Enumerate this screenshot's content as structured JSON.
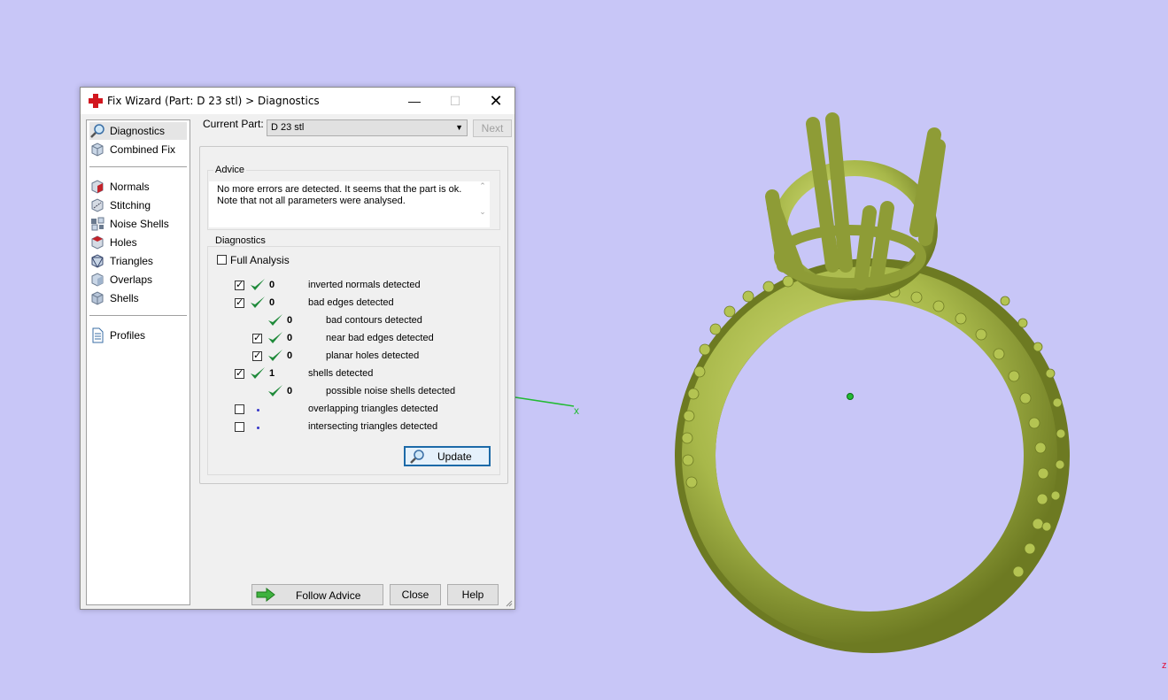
{
  "window": {
    "title": "Fix Wizard (Part: D 23 stl) > Diagnostics",
    "minimize": "—",
    "maximize": "☐",
    "close": "✕"
  },
  "nav": {
    "top_items": [
      {
        "label": "Diagnostics",
        "icon": "magnifier-icon",
        "selected": true
      },
      {
        "label": "Combined Fix",
        "icon": "cube-icon",
        "selected": false
      }
    ],
    "fix_items": [
      {
        "label": "Normals",
        "icon": "normals-cube-icon"
      },
      {
        "label": "Stitching",
        "icon": "stitching-cube-icon"
      },
      {
        "label": "Noise Shells",
        "icon": "noise-shells-icon"
      },
      {
        "label": "Holes",
        "icon": "holes-cube-icon"
      },
      {
        "label": "Triangles",
        "icon": "triangles-cube-icon"
      },
      {
        "label": "Overlaps",
        "icon": "overlaps-cube-icon"
      },
      {
        "label": "Shells",
        "icon": "shells-cube-icon"
      }
    ],
    "bottom_items": [
      {
        "label": "Profiles",
        "icon": "document-icon"
      }
    ]
  },
  "current_part": {
    "label": "Current Part:",
    "value": "D 23 stl",
    "next_label": "Next"
  },
  "advice": {
    "title": "Advice",
    "line1": "No more errors are detected. It seems that the part is ok.",
    "line2": "Note that not all parameters were analysed."
  },
  "diagnostics": {
    "title": "Diagnostics",
    "full_analysis_label": "Full Analysis",
    "full_analysis_checked": false,
    "rows": [
      {
        "checkbox": true,
        "checked": true,
        "status": "ok",
        "count": "0",
        "label": "inverted normals detected",
        "indent": 0
      },
      {
        "checkbox": true,
        "checked": true,
        "status": "ok",
        "count": "0",
        "label": "bad edges detected",
        "indent": 0
      },
      {
        "checkbox": false,
        "checked": false,
        "status": "ok",
        "count": "0",
        "label": "bad contours detected",
        "indent": 1
      },
      {
        "checkbox": true,
        "checked": true,
        "status": "ok",
        "count": "0",
        "label": "near bad edges detected",
        "indent": 1
      },
      {
        "checkbox": true,
        "checked": true,
        "status": "ok",
        "count": "0",
        "label": "planar holes detected",
        "indent": 1
      },
      {
        "checkbox": true,
        "checked": true,
        "status": "ok",
        "count": "1",
        "label": "shells detected",
        "indent": 0
      },
      {
        "checkbox": false,
        "checked": false,
        "status": "ok",
        "count": "0",
        "label": "possible noise shells detected",
        "indent": 1
      },
      {
        "checkbox": true,
        "checked": false,
        "status": "pending",
        "count": "",
        "label": "overlapping triangles detected",
        "indent": 0
      },
      {
        "checkbox": true,
        "checked": false,
        "status": "pending",
        "count": "",
        "label": "intersecting triangles detected",
        "indent": 0
      }
    ],
    "update_label": "Update"
  },
  "footer": {
    "follow_advice_label": "Follow Advice",
    "close_label": "Close",
    "help_label": "Help"
  },
  "viewport": {
    "axis_x_label": "x",
    "axis_z_label": "z",
    "model_color": "#a8b84a",
    "background_color": "#c8c6f7"
  }
}
